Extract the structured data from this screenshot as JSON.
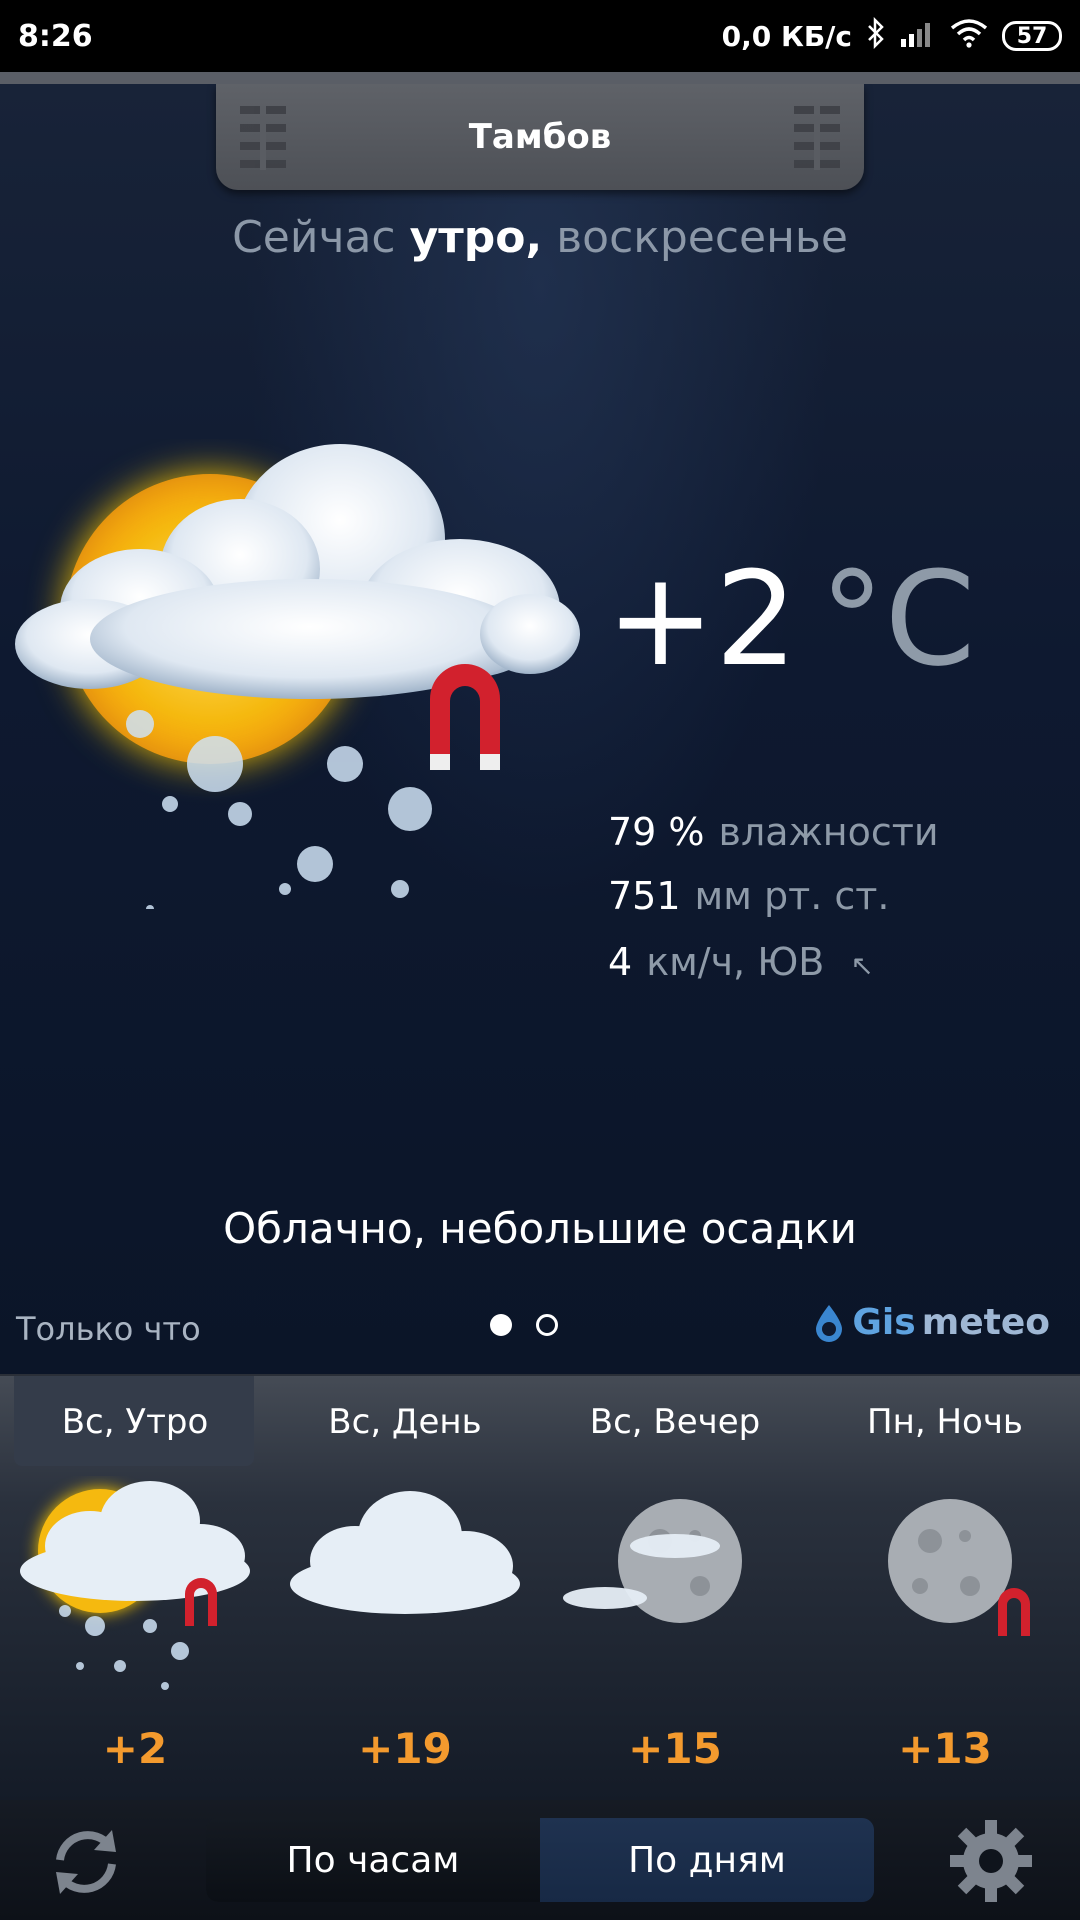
{
  "status_bar": {
    "time": "8:26",
    "network_speed": "0,0 КБ/с",
    "battery": "57",
    "icons": [
      "bluetooth-icon",
      "signal-icon",
      "wifi-icon",
      "battery-icon"
    ]
  },
  "header": {
    "city": "Тамбов"
  },
  "current": {
    "now_prefix": "Сейчас",
    "period": "утро,",
    "day": "воскресенье",
    "temperature": "+2",
    "temp_unit": "°C",
    "humidity_value": "79 %",
    "humidity_label": "влажности",
    "pressure_value": "751",
    "pressure_label": "мм рт. ст.",
    "wind_value": "4",
    "wind_label": "км/ч, ЮВ",
    "wind_arrow": "↖",
    "condition": "Облачно, небольшие осадки",
    "icon": "partly-cloudy-snow-icon"
  },
  "footer_info": {
    "updated": "Только что",
    "page_count": 2,
    "active_page": 1,
    "brand_gis": "Gis",
    "brand_meteo": "meteo"
  },
  "forecast": [
    {
      "label": "Вс, Утро",
      "temp": "+2",
      "icon": "sun-cloud-snow-icon",
      "selected": true
    },
    {
      "label": "Вс, День",
      "temp": "+19",
      "icon": "cloud-icon",
      "selected": false
    },
    {
      "label": "Вс, Вечер",
      "temp": "+15",
      "icon": "moon-cloud-icon",
      "selected": false
    },
    {
      "label": "Пн, Ночь",
      "temp": "+13",
      "icon": "moon-icon",
      "selected": false
    }
  ],
  "bottom_bar": {
    "hourly_label": "По часам",
    "daily_label": "По дням",
    "active": "daily"
  },
  "colors": {
    "accent_temp": "#f39a2e",
    "muted_text": "#8e9aa8",
    "brand": "#5fa3e0"
  }
}
